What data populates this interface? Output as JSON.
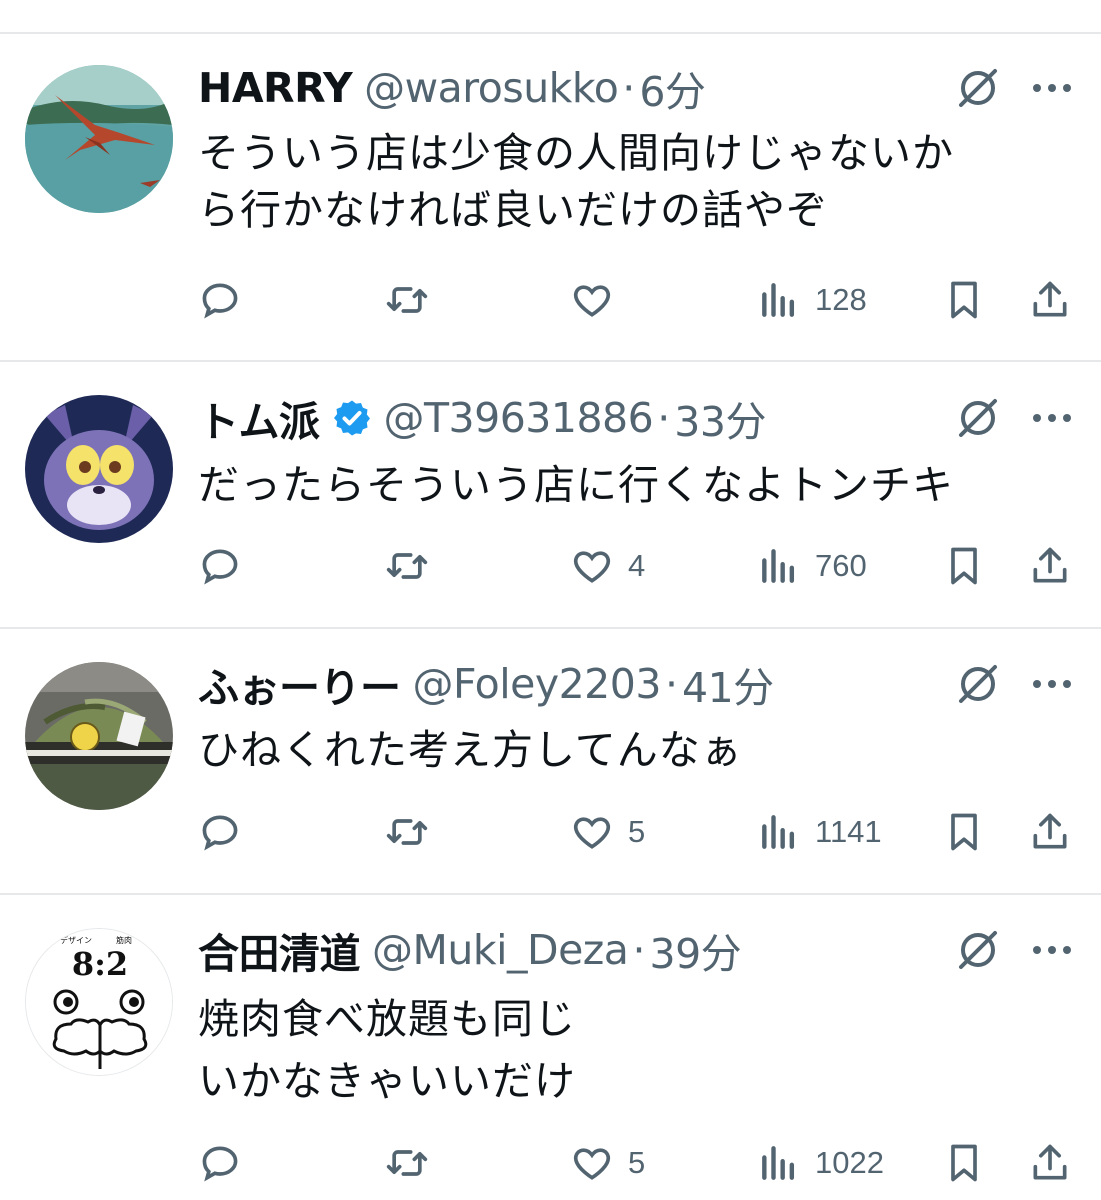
{
  "tweets": [
    {
      "name": "HARRY",
      "handle": "@warosukko",
      "time": "6分",
      "verified": false,
      "text": "そういう店は少食の人間向けじゃないか\nら行かなければ良いだけの話やぞ",
      "likes": "",
      "views": "128"
    },
    {
      "name": "トム派",
      "handle": "@T39631886",
      "time": "33分",
      "verified": true,
      "text": "だったらそういう店に行くなよトンチキ",
      "likes": "4",
      "views": "760"
    },
    {
      "name": "ふぉーりー",
      "handle": "@Foley2203",
      "time": "41分",
      "verified": false,
      "text": "ひねくれた考え方してんなぁ",
      "likes": "5",
      "views": "1141"
    },
    {
      "name": "合田清道",
      "handle": "@Muki_Deza",
      "time": "39分",
      "verified": false,
      "text": "焼肉食べ放題も同じ\nいかなきゃいいだけ",
      "likes": "5",
      "views": "1022",
      "avatar_text": {
        "top_left": "デザイン",
        "top_right": "筋肉",
        "ratio": "8:2"
      }
    }
  ],
  "separator": "·",
  "colors": {
    "text": "#0f1419",
    "secondary": "#536471",
    "divider": "#e6e8ea",
    "verified": "#1d9bf0"
  }
}
